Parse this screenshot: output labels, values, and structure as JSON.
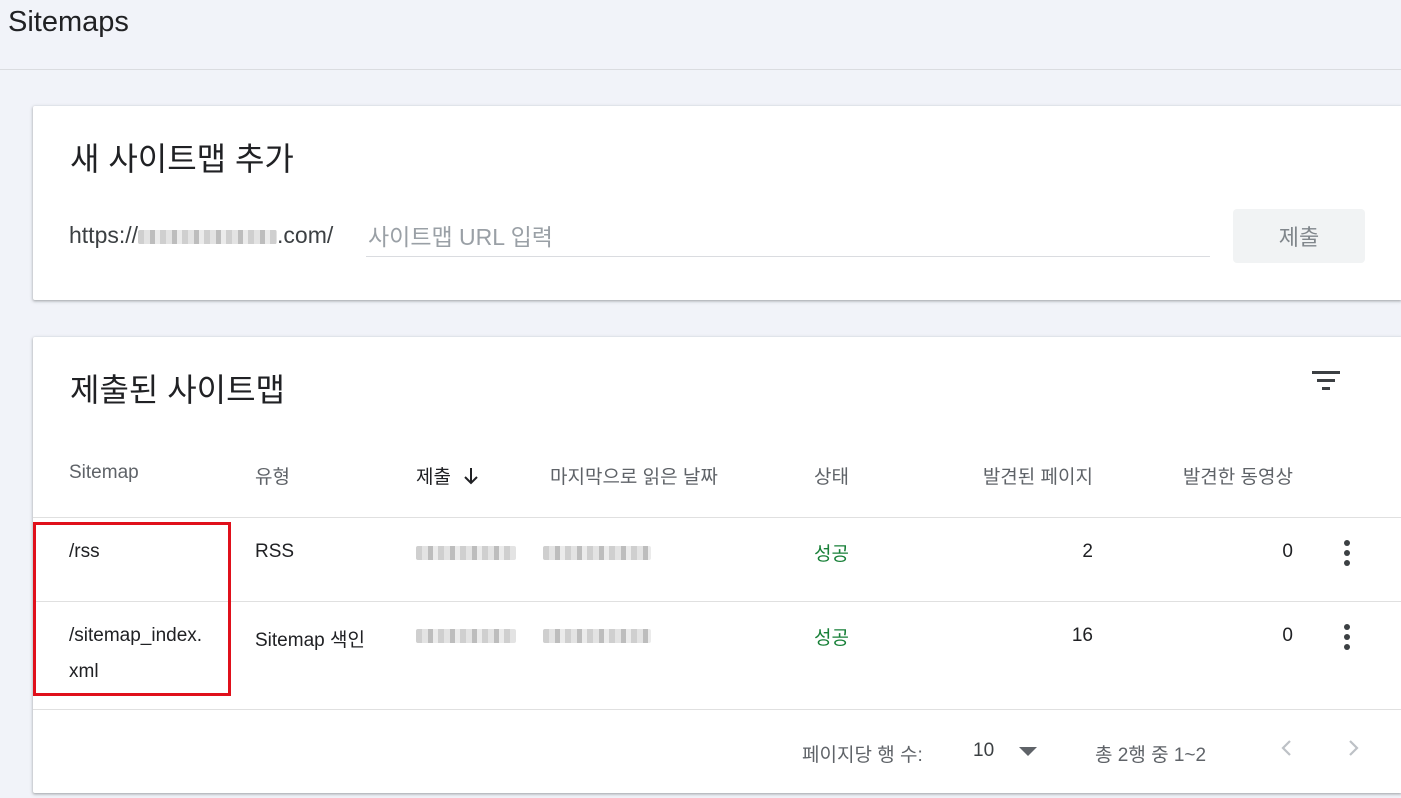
{
  "page": {
    "title": "Sitemaps"
  },
  "add_sitemap": {
    "title": "새 사이트맵 추가",
    "url_prefix_start": "https://",
    "url_prefix_end": ".com/",
    "input_placeholder": "사이트맵 URL 입력",
    "input_value": "",
    "submit_label": "제출"
  },
  "submitted": {
    "title": "제출된 사이트맵",
    "columns": {
      "sitemap": "Sitemap",
      "type": "유형",
      "submitted": "제출",
      "last_read": "마지막으로 읽은 날짜",
      "status": "상태",
      "pages": "발견된 페이지",
      "videos": "발견한 동영상"
    },
    "rows": [
      {
        "sitemap_line1": "/rss",
        "sitemap_line2": "",
        "type": "RSS",
        "status": "성공",
        "pages": "2",
        "videos": "0"
      },
      {
        "sitemap_line1": "/sitemap_index.",
        "sitemap_line2": "xml",
        "type": "Sitemap 색인",
        "status": "성공",
        "pages": "16",
        "videos": "0"
      }
    ],
    "footer": {
      "rows_per_page_label": "페이지당 행 수:",
      "rows_per_page_value": "10",
      "range_text": "총 2행 중 1~2"
    }
  },
  "colors": {
    "status_success": "#188038",
    "highlight": "#e0101b"
  },
  "icons": {
    "sort": "arrow-down-icon",
    "filter": "filter-icon",
    "row_menu": "more-vert-icon",
    "prev": "chevron-left-icon",
    "next": "chevron-right-icon"
  }
}
